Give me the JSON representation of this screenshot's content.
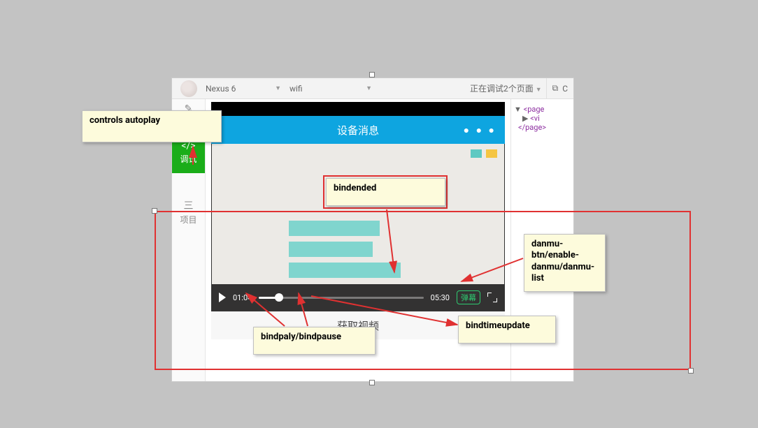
{
  "topbar": {
    "device": "Nexus 6",
    "network": "wifi",
    "debug_status": "正在调试2个页面",
    "right_icon_label": "C"
  },
  "leftnav": {
    "edit": "编辑",
    "debug_icon": "</>",
    "debug": "调试",
    "project_icon": "三",
    "project": "项目"
  },
  "phone": {
    "status_time": "",
    "title": "设备消息",
    "menu_dots": "● ● ●",
    "bottom_action": "获取视频"
  },
  "video_controls": {
    "current": "01:04",
    "duration": "05:30",
    "danmu_label": "弹幕"
  },
  "dom_panel": {
    "l1_tri": "▼",
    "l1": "<page",
    "l2_tri": "▶",
    "l2": "<vi",
    "l3": "</page>"
  },
  "callouts": {
    "controls_autoplay": "controls autoplay",
    "bindended": "bindended",
    "danmu": "danmu-btn/enable-danmu/danmu-list",
    "bindplay": "bindpaly/bindpause",
    "bindtime": "bindtimeupdate"
  }
}
